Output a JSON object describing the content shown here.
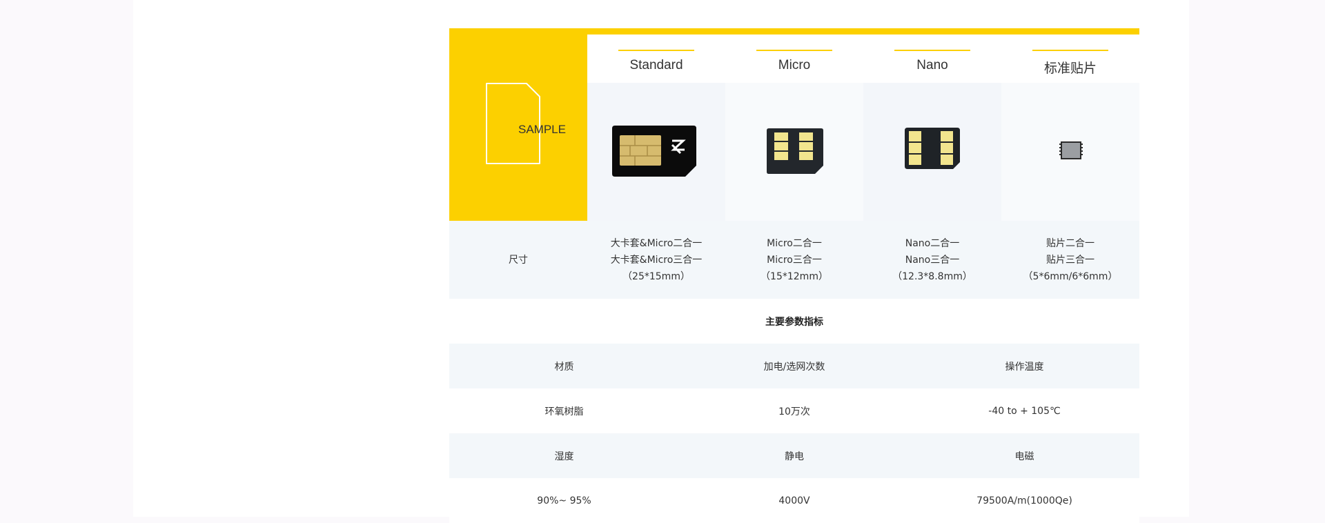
{
  "sample_label": "SAMPLE",
  "sim_types": [
    {
      "name": "Standard"
    },
    {
      "name": "Micro"
    },
    {
      "name": "Nano"
    },
    {
      "name": "标准贴片"
    }
  ],
  "size_row": {
    "label": "尺寸",
    "values": [
      [
        "大卡套&Micro二合一",
        "大卡套&Micro三合一",
        "（25*15mm）"
      ],
      [
        "Micro二合一",
        "Micro三合一",
        "（15*12mm）"
      ],
      [
        "Nano二合一",
        "Nano三合一",
        "（12.3*8.8mm）"
      ],
      [
        "贴片二合一",
        "贴片三合一",
        "（5*6mm/6*6mm）"
      ]
    ]
  },
  "params_title": "主要参数指标",
  "params": [
    [
      "材质",
      "加电/选网次数",
      "操作温度"
    ],
    [
      "环氧树脂",
      "10万次",
      "-40 to + 105℃"
    ],
    [
      "湿度",
      "静电",
      "电磁"
    ],
    [
      "90%~ 95%",
      "4000V",
      "79500A/m(1000Qe)"
    ]
  ],
  "colors": {
    "accent": "#fcd000",
    "row_shade": "#f3f7fa"
  },
  "icons": [
    "sim-outline-icon",
    "standard-sim-icon",
    "micro-sim-icon",
    "nano-sim-icon",
    "embedded-chip-icon"
  ]
}
